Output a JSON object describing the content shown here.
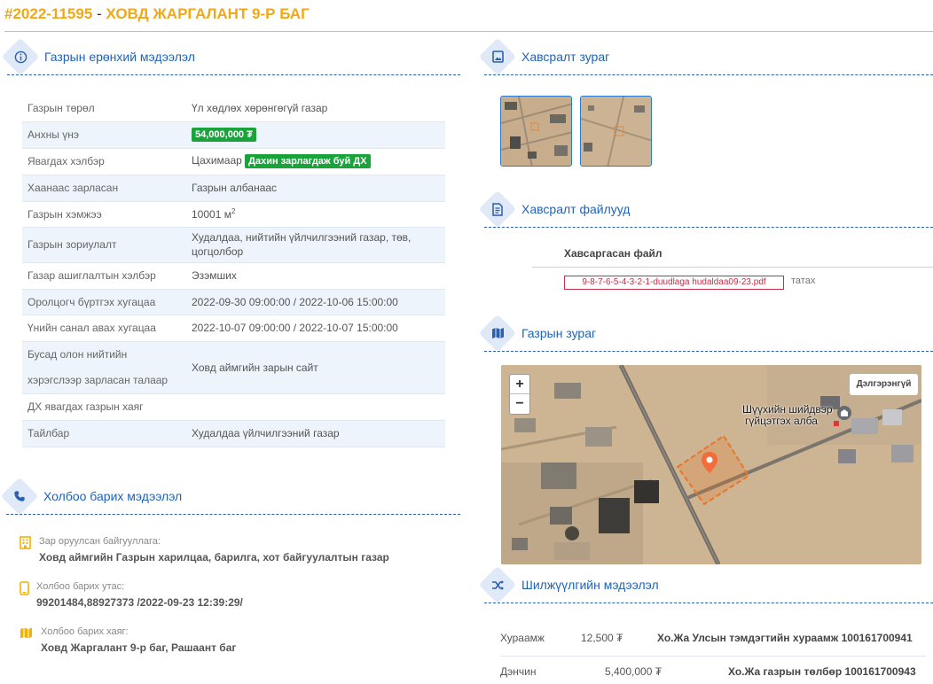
{
  "header": {
    "code": "#2022-11595",
    "separator": "-",
    "name": "ХОВД ЖАРГАЛАНТ 9-Р БАГ"
  },
  "general": {
    "title": "Газрын ерөнхий мэдээлэл",
    "rows": [
      {
        "key": "Газрын төрөл",
        "value": "Үл хөдлөх хөрөнгөгүй газар"
      },
      {
        "key": "Анхны үнэ",
        "badge": "54,000,000 ₮"
      },
      {
        "key": "Явагдах хэлбэр",
        "value": "Цахимаар",
        "badge": "Дахин зарлагдаж буй ДХ"
      },
      {
        "key": "Хаанаас зарласан",
        "value": "Газрын албанаас"
      },
      {
        "key": "Газрын хэмжээ",
        "value": "10001 м",
        "unit_sup": "2"
      },
      {
        "key": "Газрын зориулалт",
        "value": "Худалдаа, нийтийн үйлчилгээний газар, төв, цогцолбор"
      },
      {
        "key": "Газар ашиглалтын хэлбэр",
        "value": "Эзэмших"
      },
      {
        "key": "Оролцогч бүртгэх хугацаа",
        "value": "2022-09-30 09:00:00 / 2022-10-06 15:00:00"
      },
      {
        "key": "Үнийн санал авах хугацаа",
        "value": "2022-10-07 09:00:00 / 2022-10-07 15:00:00"
      },
      {
        "key": "Бусад олон нийтийн хэрэгслээр зарласан талаар",
        "value": "Ховд аймгийн зарын сайт"
      },
      {
        "key": "ДХ явагдах газрын хаяг",
        "value": ""
      },
      {
        "key": "Тайлбар",
        "value": "Худалдаа үйлчилгээний газар"
      }
    ]
  },
  "contact": {
    "title": "Холбоо барих мэдээлэл",
    "items": [
      {
        "label": "Зар оруулсан байгууллага:",
        "value": "Ховд аймгийн Газрын харилцаа, барилга, хот байгуулалтын газар",
        "icon": "building-icon"
      },
      {
        "label": "Холбоо барих утас:",
        "value": "99201484,88927373 /2022-09-23 12:39:29/",
        "icon": "phone-icon"
      },
      {
        "label": "Холбоо барих хаяг:",
        "value": "Ховд Жаргалант 9-р баг, Рашаант баг",
        "icon": "map-icon"
      }
    ]
  },
  "images": {
    "title": "Хавсралт зураг"
  },
  "files": {
    "title": "Хавсралт файлууд",
    "column_header": "Хавсаргасан файл",
    "file_name": "9-8-7-6-5-4-3-2-1-duudlaga hudaldaa09-23.pdf",
    "download_label": "татах"
  },
  "map": {
    "title": "Газрын зураг",
    "zoom_in": "+",
    "zoom_out": "−",
    "more_button": "Дэлгэрэнгүй",
    "poi_line1": "Шүүхийн шийдвэр",
    "poi_line2": "гүйцэтгэх алба"
  },
  "transfer": {
    "title": "Шилжүүлгийн мэдээлэл",
    "rows": [
      {
        "key": "Хураамж",
        "amount": "12,500 ₮",
        "desc": "Хо.Жа Улсын тэмдэгтийн хураамж 100161700941"
      },
      {
        "key": "Дэнчин",
        "amount": "5,400,000 ₮",
        "desc": "Хо.Жа газрын төлбөр 100161700943"
      }
    ]
  },
  "colors": {
    "accent_yellow": "#f0a818",
    "link_blue": "#1e63b8",
    "badge_green": "#1aa33a",
    "file_red": "#c0304a"
  }
}
